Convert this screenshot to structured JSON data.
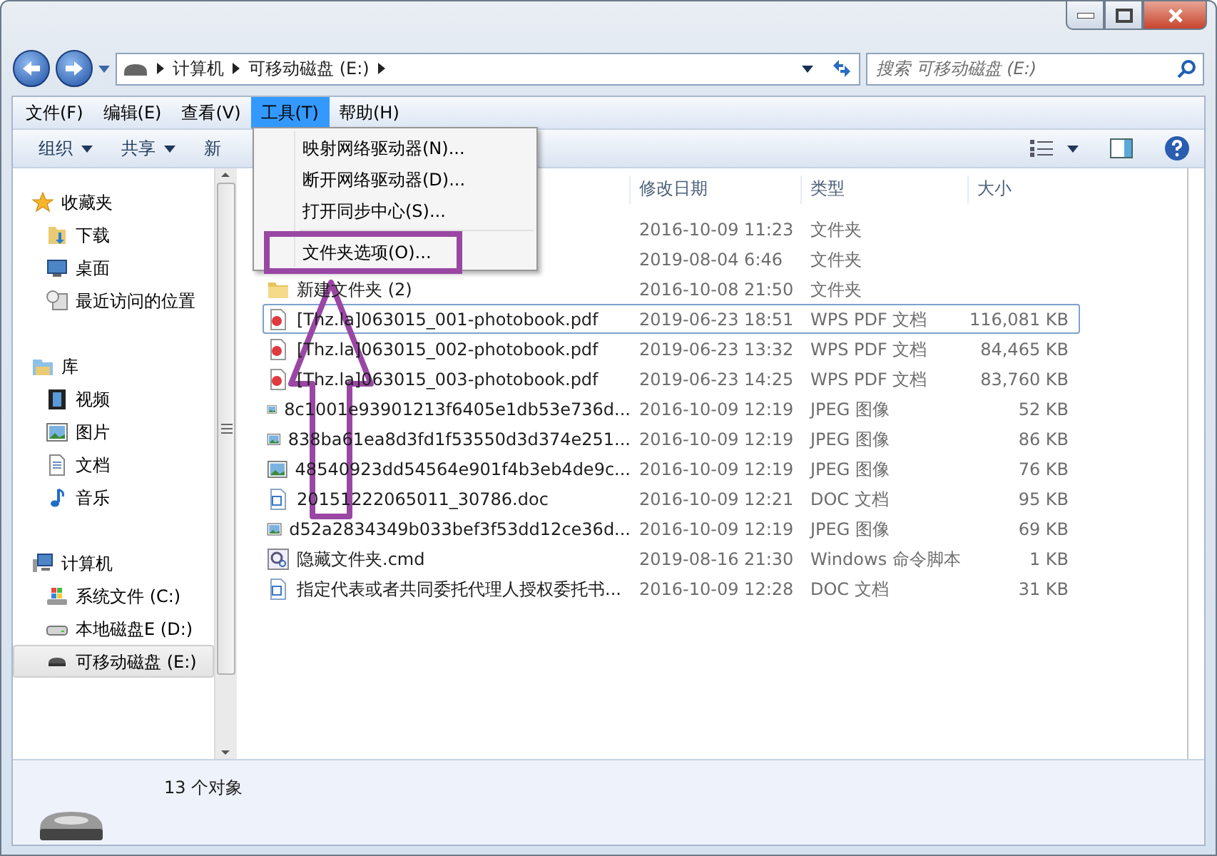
{
  "address_bar": {
    "path": [
      "计算机",
      "可移动磁盘 (E:)"
    ]
  },
  "search": {
    "placeholder": "搜索 可移动磁盘 (E:)"
  },
  "menu_bar": [
    {
      "label": "文件(F)",
      "selected": false
    },
    {
      "label": "编辑(E)",
      "selected": false
    },
    {
      "label": "查看(V)",
      "selected": false
    },
    {
      "label": "工具(T)",
      "selected": true
    },
    {
      "label": "帮助(H)",
      "selected": false
    }
  ],
  "open_menu": {
    "items": [
      {
        "kind": "item",
        "label": "映射网络驱动器(N)..."
      },
      {
        "kind": "item",
        "label": "断开网络驱动器(D)..."
      },
      {
        "kind": "item",
        "label": "打开同步中心(S)..."
      },
      {
        "kind": "separator"
      },
      {
        "kind": "item",
        "label": "文件夹选项(O)..."
      }
    ]
  },
  "toolbar": [
    {
      "label": "组织",
      "dropdown": true
    },
    {
      "label": "共享",
      "dropdown": true
    },
    {
      "label": "新",
      "dropdown": false
    }
  ],
  "sidebar": [
    {
      "label": "收藏夹",
      "kind": "star",
      "selected": false,
      "children": [
        {
          "label": "下载",
          "kind": "download",
          "selected": false
        },
        {
          "label": "桌面",
          "kind": "desktop",
          "selected": false
        },
        {
          "label": "最近访问的位置",
          "kind": "recent",
          "selected": false
        }
      ]
    },
    {
      "label": "库",
      "kind": "library",
      "selected": false,
      "children": [
        {
          "label": "视频",
          "kind": "video",
          "selected": false
        },
        {
          "label": "图片",
          "kind": "image",
          "selected": false
        },
        {
          "label": "文档",
          "kind": "doc",
          "selected": false
        },
        {
          "label": "音乐",
          "kind": "music",
          "selected": false
        }
      ]
    },
    {
      "label": "计算机",
      "kind": "computer",
      "selected": false,
      "children": [
        {
          "label": "系统文件 (C:)",
          "kind": "sysdrive",
          "selected": false
        },
        {
          "label": "本地磁盘E (D:)",
          "kind": "drive",
          "selected": false
        },
        {
          "label": "可移动磁盘 (E:)",
          "kind": "removable",
          "selected": true
        }
      ]
    }
  ],
  "table": {
    "columns": [
      "修改日期",
      "类型",
      "大小"
    ],
    "rows": [
      {
        "date": "2016-10-09 11:23",
        "type": "文件夹",
        "focused": false
      },
      {
        "date": "2019-08-04 6:46",
        "type": "文件夹",
        "focused": false
      },
      {
        "kind": "folder",
        "name": "新建文件夹 (2)",
        "date": "2016-10-08 21:50",
        "type": "文件夹",
        "focused": false
      },
      {
        "kind": "pdf",
        "name": "[Thz.la]063015_001-photobook.pdf",
        "date": "2019-06-23 18:51",
        "type": "WPS PDF 文档",
        "size": "116,081 KB",
        "focused": true
      },
      {
        "kind": "pdf",
        "name": "[Thz.la]063015_002-photobook.pdf",
        "date": "2019-06-23 13:32",
        "type": "WPS PDF 文档",
        "size": "84,465 KB",
        "focused": false
      },
      {
        "kind": "pdf",
        "name": "[Thz.la]063015_003-photobook.pdf",
        "date": "2019-06-23 14:25",
        "type": "WPS PDF 文档",
        "size": "83,760 KB",
        "focused": false
      },
      {
        "kind": "image",
        "name": "8c1001e93901213f6405e1db53e736d...",
        "date": "2016-10-09 12:19",
        "type": "JPEG 图像",
        "size": "52 KB",
        "focused": false
      },
      {
        "kind": "image",
        "name": "838ba61ea8d3fd1f53550d3d374e251...",
        "date": "2016-10-09 12:19",
        "type": "JPEG 图像",
        "size": "86 KB",
        "focused": false
      },
      {
        "kind": "image",
        "name": "48540923dd54564e901f4b3eb4de9c...",
        "date": "2016-10-09 12:19",
        "type": "JPEG 图像",
        "size": "76 KB",
        "focused": false
      },
      {
        "kind": "word",
        "name": "20151222065011_30786.doc",
        "date": "2016-10-09 12:21",
        "type": "DOC 文档",
        "size": "95 KB",
        "focused": false
      },
      {
        "kind": "image",
        "name": "d52a2834349b033bef3f53dd12ce36d...",
        "date": "2016-10-09 12:19",
        "type": "JPEG 图像",
        "size": "69 KB",
        "focused": false
      },
      {
        "kind": "cmd",
        "name": "隐藏文件夹.cmd",
        "date": "2019-08-16 21:30",
        "type": "Windows 命令脚本",
        "size": "1 KB",
        "focused": false
      },
      {
        "kind": "word",
        "name": "指定代表或者共同委托代理人授权委托书...",
        "date": "2016-10-09 12:28",
        "type": "DOC 文档",
        "size": "31 KB",
        "focused": false
      }
    ]
  },
  "status_bar": {
    "text": "13 个对象"
  }
}
